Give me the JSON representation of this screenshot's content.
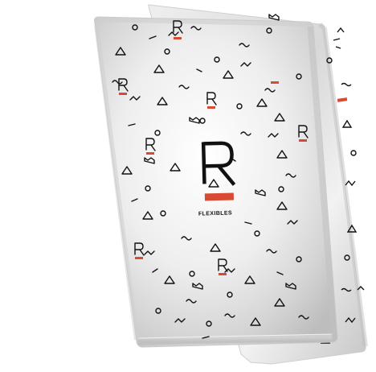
{
  "product": {
    "brand_text": "FLEXIBLES",
    "logo_letter": "R",
    "logo_name": "r-logo-icon"
  },
  "colors": {
    "accent": "#d94a35",
    "ink": "#111111",
    "film_light": "#f4f4f4",
    "film_mid": "#dcdcdc",
    "film_shadow": "#b9b9b9"
  },
  "pattern": {
    "icons": [
      "triangle-icon",
      "circle-icon",
      "zigzag-icon",
      "squiggle-icon",
      "crown-icon",
      "dash-icon"
    ]
  }
}
